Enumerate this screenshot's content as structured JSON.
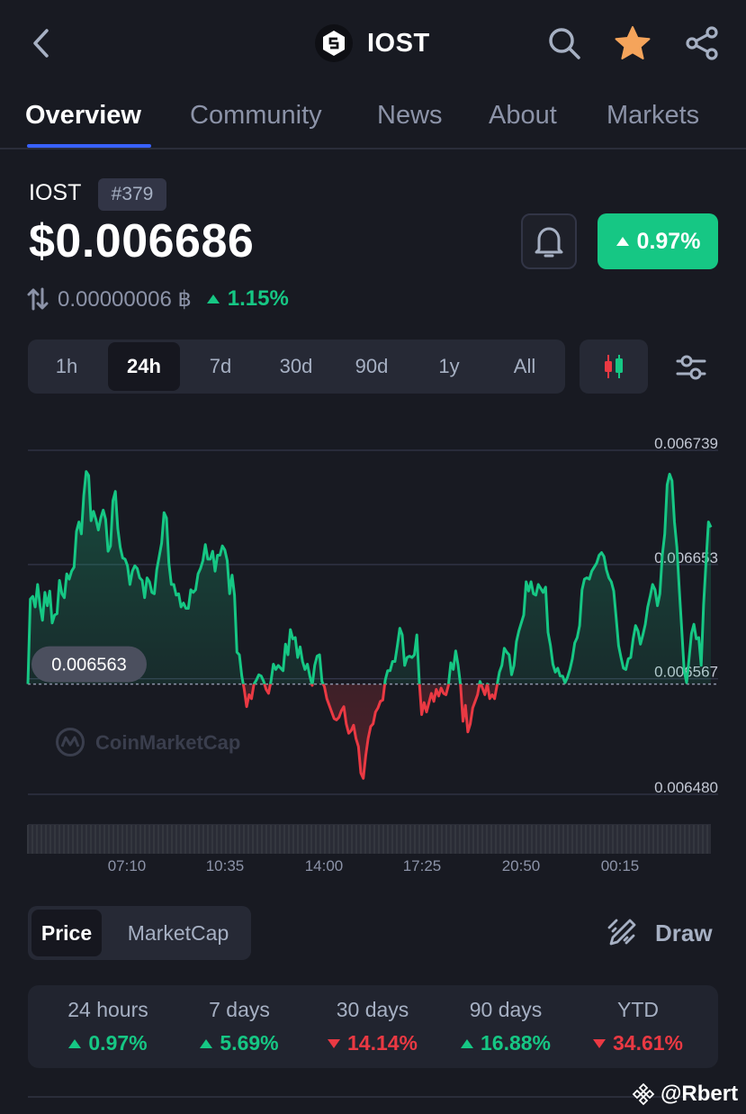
{
  "header": {
    "coin_name": "IOST",
    "icons": [
      "back-icon",
      "iost-logo-icon",
      "search-icon",
      "star-icon",
      "share-icon"
    ],
    "star_color": "#f5a45b"
  },
  "tabs": [
    {
      "label": "Overview",
      "active": true
    },
    {
      "label": "Community"
    },
    {
      "label": "News"
    },
    {
      "label": "About"
    },
    {
      "label": "Markets"
    }
  ],
  "coin": {
    "symbol": "IOST",
    "rank": "#379",
    "price": "$0.006686",
    "change_24h": "0.97%",
    "btc_price": "0.00000006 ฿",
    "btc_change": "1.15%"
  },
  "ranges": [
    "1h",
    "24h",
    "7d",
    "30d",
    "90d",
    "1y",
    "All"
  ],
  "active_range": "24h",
  "chart_data": {
    "type": "line",
    "y_ticks": [
      "0.006739",
      "0.006653",
      "0.006567",
      "0.006480"
    ],
    "ylim": [
      0.00648,
      0.006739
    ],
    "x_ticks": [
      "07:10",
      "10:35",
      "14:00",
      "17:25",
      "20:50",
      "00:15"
    ],
    "baseline": 0.006563,
    "baseline_label": "0.006563",
    "watermark": "CoinMarketCap",
    "up_color": "#16c784",
    "down_color": "#ea3943",
    "series": [
      {
        "values": [
          0.006563,
          0.006627,
          0.006629,
          0.006621,
          0.006638,
          0.006622,
          0.006611,
          0.006632,
          0.006622,
          0.006633,
          0.006609,
          0.006615,
          0.006616,
          0.006641,
          0.006631,
          0.006628,
          0.006646,
          0.006642,
          0.006648,
          0.006651,
          0.006678,
          0.006685,
          0.006676,
          0.006705,
          0.006723,
          0.00672,
          0.006686,
          0.006693,
          0.006687,
          0.006679,
          0.006688,
          0.006694,
          0.006687,
          0.006663,
          0.006667,
          0.006701,
          0.006708,
          0.00668,
          0.006666,
          0.006658,
          0.006657,
          0.006652,
          0.006638,
          0.006648,
          0.006652,
          0.00665,
          0.006643,
          0.006641,
          0.006628,
          0.006643,
          0.00664,
          0.006632,
          0.006631,
          0.006649,
          0.006659,
          0.006669,
          0.006692,
          0.006688,
          0.006654,
          0.006638,
          0.006638,
          0.00663,
          0.006631,
          0.006621,
          0.006624,
          0.00662,
          0.00662,
          0.006634,
          0.006632,
          0.006634,
          0.006646,
          0.00665,
          0.006656,
          0.006668,
          0.006657,
          0.006657,
          0.006663,
          0.006648,
          0.00666,
          0.00666,
          0.006667,
          0.006664,
          0.006656,
          0.006631,
          0.006645,
          0.00663,
          0.006587,
          0.006585,
          0.006569,
          0.006559,
          0.006546,
          0.006555,
          0.006552,
          0.006563,
          0.006566,
          0.00657,
          0.006569,
          0.006565,
          0.006559,
          0.006556,
          0.006565,
          0.006578,
          0.006574,
          0.006577,
          0.006575,
          0.006573,
          0.006593,
          0.006585,
          0.006604,
          0.006597,
          0.006598,
          0.006583,
          0.006591,
          0.00658,
          0.006574,
          0.006578,
          0.006569,
          0.006562,
          0.006577,
          0.006584,
          0.006585,
          0.006565,
          0.006561,
          0.006552,
          0.006547,
          0.006542,
          0.006537,
          0.006536,
          0.006538,
          0.006543,
          0.006546,
          0.006533,
          0.006526,
          0.006528,
          0.006532,
          0.006522,
          0.006516,
          0.006496,
          0.006492,
          0.006509,
          0.006522,
          0.006531,
          0.006533,
          0.006542,
          0.006545,
          0.00655,
          0.006551,
          0.006566,
          0.006573,
          0.006573,
          0.00658,
          0.00658,
          0.006592,
          0.006605,
          0.0066,
          0.006577,
          0.006583,
          0.006584,
          0.006583,
          0.006585,
          0.0066,
          0.006565,
          0.00654,
          0.006549,
          0.006542,
          0.006549,
          0.006556,
          0.00655,
          0.006559,
          0.006554,
          0.00656,
          0.006556,
          0.006555,
          0.006562,
          0.006579,
          0.006574,
          0.006588,
          0.006577,
          0.006562,
          0.006535,
          0.006547,
          0.006527,
          0.006533,
          0.006545,
          0.00655,
          0.006555,
          0.006565,
          0.00656,
          0.006555,
          0.006563,
          0.006552,
          0.006555,
          0.006552,
          0.006562,
          0.006572,
          0.006577,
          0.00659,
          0.006587,
          0.006585,
          0.00657,
          0.006577,
          0.006595,
          0.006603,
          0.006609,
          0.006615,
          0.00664,
          0.006633,
          0.00664,
          0.006631,
          0.00663,
          0.006638,
          0.006635,
          0.006632,
          0.006636,
          0.006602,
          0.006592,
          0.006578,
          0.006572,
          0.006575,
          0.006569,
          0.006569,
          0.006564,
          0.006568,
          0.006574,
          0.006582,
          0.006594,
          0.006598,
          0.006607,
          0.006634,
          0.006642,
          0.006643,
          0.006642,
          0.006648,
          0.006651,
          0.006654,
          0.00666,
          0.006662,
          0.006659,
          0.006649,
          0.006643,
          0.00664,
          0.006633,
          0.006613,
          0.006592,
          0.006583,
          0.006575,
          0.006574,
          0.006582,
          0.006583,
          0.006597,
          0.006607,
          0.006603,
          0.006593,
          0.0066,
          0.006608,
          0.006621,
          0.006629,
          0.006638,
          0.006634,
          0.006622,
          0.006631,
          0.00666,
          0.006676,
          0.006713,
          0.006721,
          0.006716,
          0.006685,
          0.006666,
          0.006634,
          0.006604,
          0.006573,
          0.006564,
          0.006582,
          0.006601,
          0.006608,
          0.006597,
          0.006598,
          0.006577,
          0.006623,
          0.006655,
          0.006685,
          0.006681
        ]
      }
    ]
  },
  "chart_mode": {
    "options": [
      "Price",
      "MarketCap"
    ],
    "active": "Price"
  },
  "draw_label": "Draw",
  "performance": [
    {
      "label": "24 hours",
      "value": "0.97%",
      "dir": "up"
    },
    {
      "label": "7 days",
      "value": "5.69%",
      "dir": "up"
    },
    {
      "label": "30 days",
      "value": "14.14%",
      "dir": "down"
    },
    {
      "label": "90 days",
      "value": "16.88%",
      "dir": "up"
    },
    {
      "label": "YTD",
      "value": "34.61%",
      "dir": "down"
    }
  ],
  "watermark_user": "@Rbert"
}
